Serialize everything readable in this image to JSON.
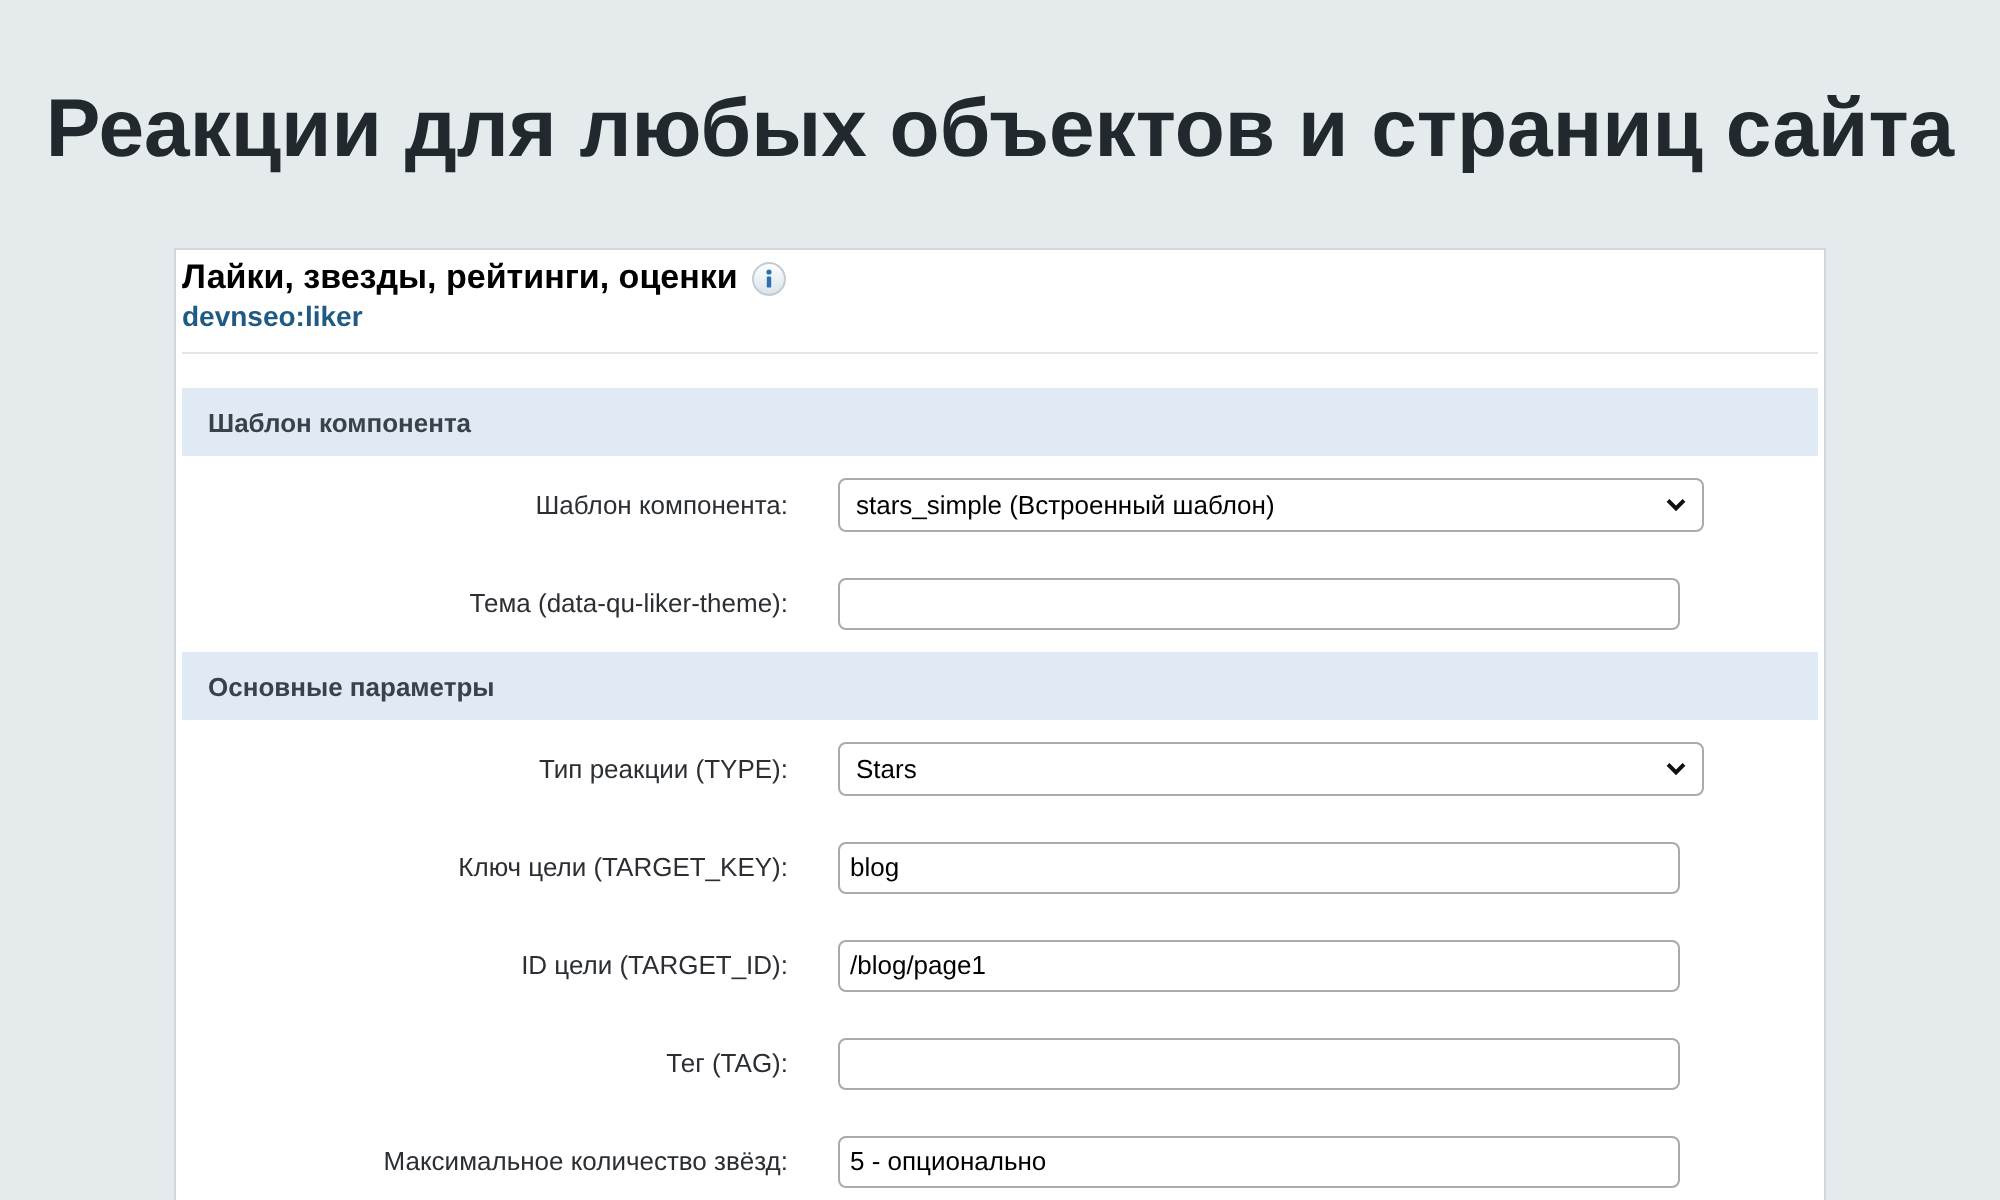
{
  "headline": "Реакции для любых объектов и страниц сайта",
  "panel": {
    "title": "Лайки, звезды, рейтинги, оценки",
    "subtitle": "devnseo:liker",
    "sections": [
      {
        "title": "Шаблон компонента",
        "fields": [
          {
            "kind": "select",
            "label": "Шаблон компонента:",
            "value": "stars_simple (Встроенный шаблон)"
          },
          {
            "kind": "input",
            "label": "Тема (data-qu-liker-theme):"
          }
        ]
      },
      {
        "title": "Основные параметры",
        "fields": [
          {
            "kind": "select",
            "label": "Тип реакции (TYPE):",
            "value": "Stars"
          },
          {
            "kind": "input",
            "label": "Ключ цели (TARGET_KEY):",
            "value": "blog"
          },
          {
            "kind": "input",
            "label": "ID цели (TARGET_ID):",
            "value": "/blog/page1"
          },
          {
            "kind": "input",
            "label": "Тег (TAG):"
          },
          {
            "kind": "input",
            "label": "Максимальное количество звёзд:",
            "value": "5 - опционально"
          }
        ]
      }
    ]
  }
}
